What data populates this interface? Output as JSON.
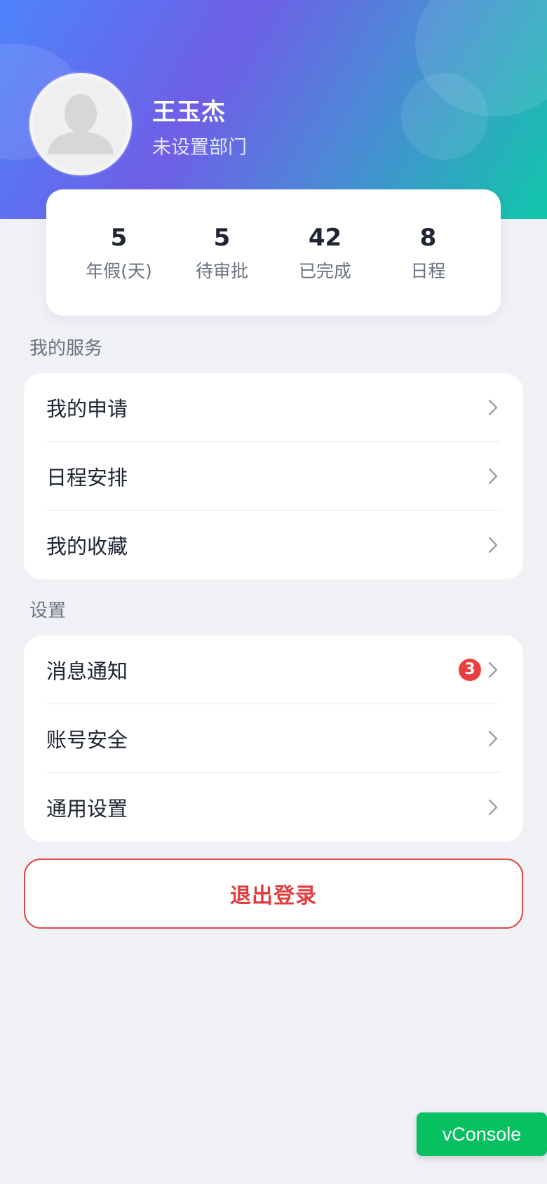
{
  "profile": {
    "name": "王玉杰",
    "department": "未设置部门"
  },
  "stats": [
    {
      "value": "5",
      "label": "年假(天)"
    },
    {
      "value": "5",
      "label": "待审批"
    },
    {
      "value": "42",
      "label": "已完成"
    },
    {
      "value": "8",
      "label": "日程"
    }
  ],
  "services": {
    "title": "我的服务",
    "items": [
      {
        "label": "我的申请"
      },
      {
        "label": "日程安排"
      },
      {
        "label": "我的收藏"
      }
    ]
  },
  "settings": {
    "title": "设置",
    "items": [
      {
        "label": "消息通知",
        "badge": "3"
      },
      {
        "label": "账号安全"
      },
      {
        "label": "通用设置"
      }
    ]
  },
  "logout_label": "退出登录",
  "vconsole_label": "vConsole",
  "colors": {
    "badge": "#ec3e3e",
    "logout": "#e23c3c",
    "vconsole": "#07c160"
  },
  "icons": {
    "avatar": "default-avatar-icon",
    "row_arrow": "chevron-right-icon"
  }
}
